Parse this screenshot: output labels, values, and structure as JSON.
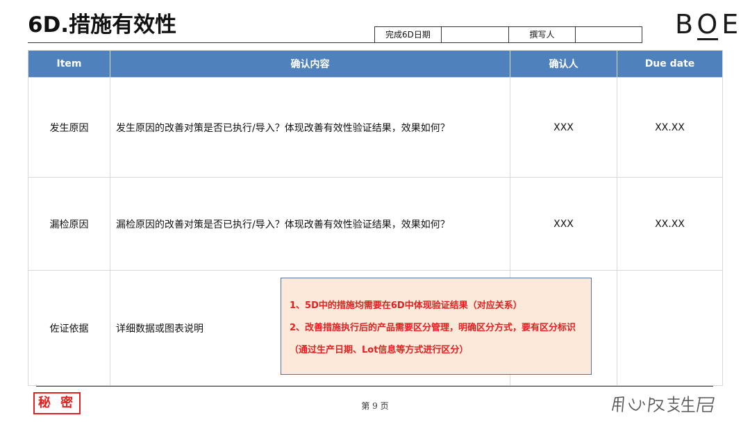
{
  "title": "6D.措施有效性",
  "meta": {
    "complete_date_label": "完成6D日期",
    "complete_date_value": "",
    "author_label": "撰写人",
    "author_value": ""
  },
  "logo_text": "BOE",
  "table": {
    "headers": [
      "Item",
      "确认内容",
      "确认人",
      "Due date"
    ],
    "rows": [
      {
        "item": "发生原因",
        "content": "发生原因的改善对策是否已执行/导入？体现改善有效性验证结果，效果如何？",
        "confirmer": "XXX",
        "due": "XX.XX"
      },
      {
        "item": "漏检原因",
        "content": "漏检原因的改善对策是否已执行/导入？体现改善有效性验证结果，效果如何？",
        "confirmer": "XXX",
        "due": "XX.XX"
      },
      {
        "item": "佐证依据",
        "content": "详细数据或图表说明",
        "confirmer": "",
        "due": ""
      }
    ]
  },
  "note": {
    "lines": [
      "1、5D中的措施均需要在6D中体现验证结果（对应关系）",
      "2、改善措施执行后的产品需要区分管理，明确区分方式，要有区分标识",
      "（通过生产日期、Lot信息等方式进行区分）"
    ]
  },
  "footer": {
    "secret_label": "秘 密",
    "page_label": "第 9 页",
    "slogan": "用心改变生活"
  },
  "colors": {
    "header_blue": "#4f81bd",
    "note_red": "#e32020",
    "note_bg": "#fde9d9"
  }
}
